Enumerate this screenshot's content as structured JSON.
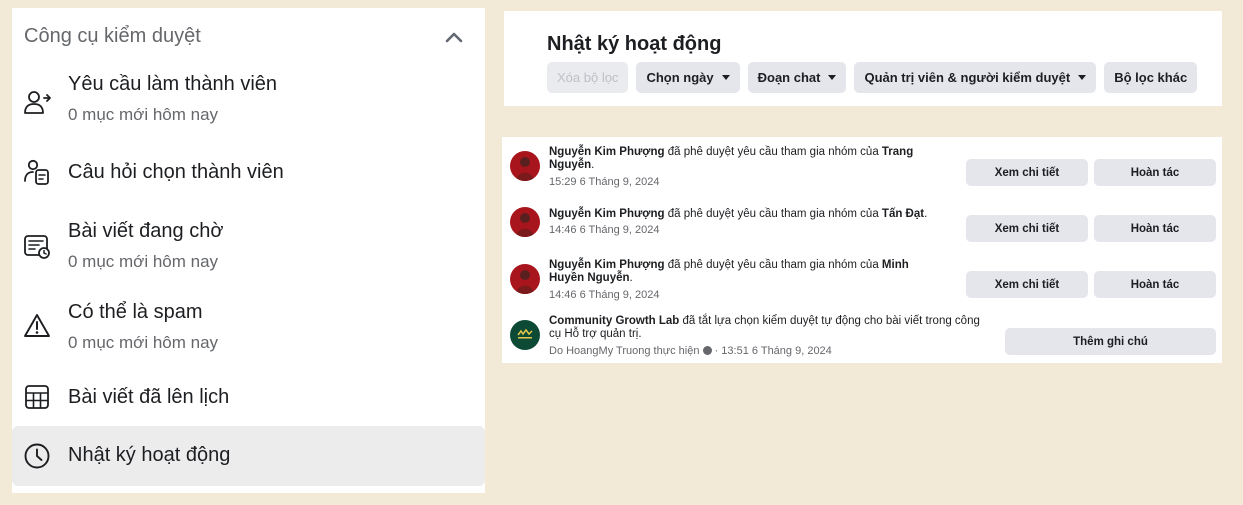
{
  "sidebar": {
    "section_title": "Công cụ kiểm duyệt",
    "items": [
      {
        "title": "Yêu cầu làm thành viên",
        "subtitle": "0 mục mới hôm nay",
        "icon": "person-add-icon"
      },
      {
        "title": "Câu hỏi chọn thành viên",
        "subtitle": "",
        "icon": "member-questions-icon"
      },
      {
        "title": "Bài viết đang chờ",
        "subtitle": "0 mục mới hôm nay",
        "icon": "pending-posts-icon"
      },
      {
        "title": "Có thể là spam",
        "subtitle": "0 mục mới hôm nay",
        "icon": "warning-icon"
      },
      {
        "title": "Bài viết đã lên lịch",
        "subtitle": "",
        "icon": "calendar-icon"
      },
      {
        "title": "Nhật ký hoạt động",
        "subtitle": "",
        "icon": "clock-icon",
        "active": true
      }
    ]
  },
  "activity_log": {
    "title": "Nhật ký hoạt động",
    "filters": {
      "clear": "Xóa bộ lọc",
      "date": "Chọn ngày",
      "chat": "Đoạn chat",
      "admins": "Quản trị viên & người kiểm duyệt",
      "more": "Bộ lọc khác"
    },
    "entries": [
      {
        "actor": "Nguyễn Kim Phượng",
        "action": " đã phê duyệt yêu cầu tham gia nhóm của ",
        "target": "Trang Nguyễn",
        "end": ".",
        "time": "15:29 6 Tháng 9, 2024",
        "btn_details": "Xem chi tiết",
        "btn_undo": "Hoàn tác"
      },
      {
        "actor": "Nguyễn Kim Phượng",
        "action": " đã phê duyệt yêu cầu tham gia nhóm của ",
        "target": "Tấn Đạt",
        "end": ".",
        "time": "14:46 6 Tháng 9, 2024",
        "btn_details": "Xem chi tiết",
        "btn_undo": "Hoàn tác"
      },
      {
        "actor": "Nguyễn Kim Phượng",
        "action": " đã phê duyệt yêu cầu tham gia nhóm của ",
        "target": "Minh Huyền Nguyễn",
        "end": ".",
        "time": "14:46 6 Tháng 9, 2024",
        "btn_details": "Xem chi tiết",
        "btn_undo": "Hoàn tác"
      },
      {
        "actor": "Community Growth Lab",
        "action": " đã tắt lựa chọn kiểm duyệt tự động cho bài viết trong công cụ Hỗ trợ quản trị.",
        "meta_prefix": "Do HoangMy Truong thực hiện",
        "time": " · 13:51 6 Tháng 9, 2024",
        "btn_note": "Thêm ghi chú"
      }
    ]
  }
}
